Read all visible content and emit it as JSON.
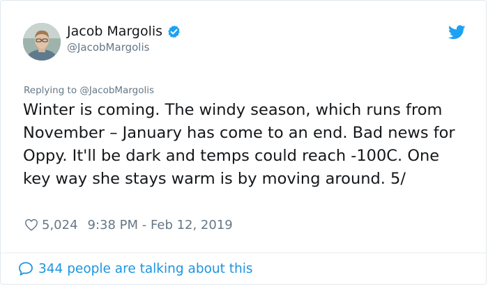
{
  "author": {
    "display_name": "Jacob Margolis",
    "handle": "@JacobMargolis"
  },
  "tweet": {
    "replying_to": "Replying to @JacobMargolis",
    "text": "Winter is coming. The windy season, which runs from November – January has come to an end. Bad news for Oppy. It'll be dark and temps could reach -100C. One key way she stays warm is by moving around. 5/",
    "like_count": "5,024",
    "timestamp": "9:38 PM - Feb 12, 2019"
  },
  "footer": {
    "talking_label": "344 people are talking about this"
  },
  "colors": {
    "twitter_blue": "#1da1f2",
    "link_blue": "#1b95e0",
    "secondary_text": "#657786",
    "primary_text": "#14171a"
  },
  "icons": {
    "verified": "verified-badge-icon",
    "logo": "twitter-bird-icon",
    "like": "heart-icon",
    "reply": "speech-bubble-icon"
  }
}
